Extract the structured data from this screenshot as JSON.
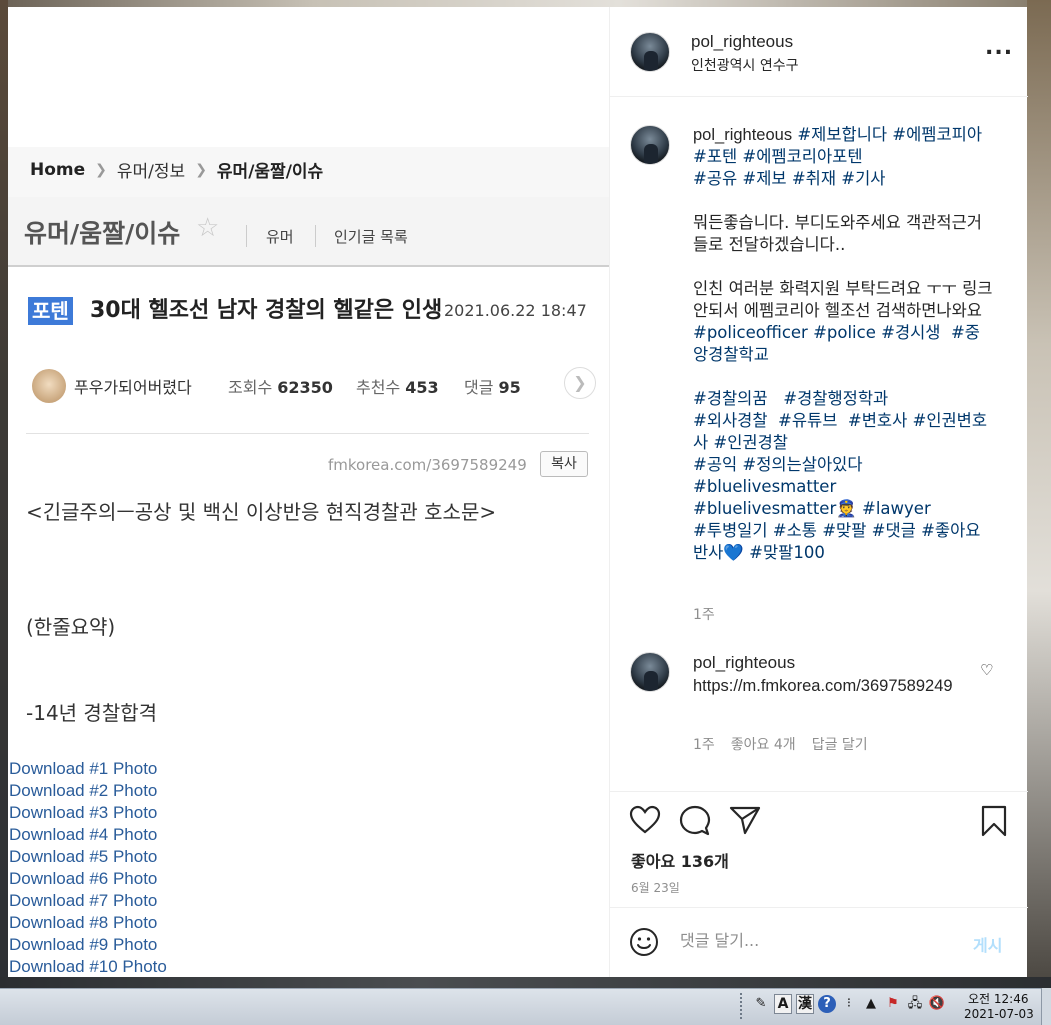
{
  "image_post": {
    "breadcrumb": {
      "home": "Home",
      "level1": "유머/정보",
      "level2": "유머/움짤/이슈"
    },
    "board": {
      "title": "유머/움짤/이슈",
      "link1": "유머",
      "link2": "인기글 목록"
    },
    "post": {
      "tag": "포텐",
      "title": "30대 헬조선 남자 경찰의 헬같은 인생",
      "date": "2021.06.22 18:47",
      "author": "푸우가되어버렸다",
      "views_label": "조회수",
      "views": "62350",
      "recommend_label": "추천수",
      "recommend": "453",
      "comments_label": "댓글",
      "comments": "95",
      "url": "fmkorea.com/3697589249",
      "copy_label": "복사",
      "body": [
        "<긴글주의ㅡ공상 및 백신 이상반응 현직경찰관 호소문>",
        "(한줄요약)",
        "-14년 경찰합격"
      ]
    }
  },
  "downloads": [
    "Download #1 Photo",
    "Download #2 Photo",
    "Download #3 Photo",
    "Download #4 Photo",
    "Download #5 Photo",
    "Download #6 Photo",
    "Download #7 Photo",
    "Download #8 Photo",
    "Download #9 Photo",
    "Download #10 Photo"
  ],
  "instagram": {
    "header": {
      "username": "pol_righteous",
      "location": "인천광역시 연수구",
      "more": "..."
    },
    "caption": {
      "username": "pol_righteous",
      "tags1": "#제보합니다 #에펨코피아 #포텐 #에펨코리아포텐\n#공유 #제보 #취재 #기사",
      "text1": "\n\n뭐든좋습니다. 부디도와주세요 객관적근거들로 전달하겠습니다..\n\n인친 여러분 화력지원 부탁드려요 ㅜㅜ 링크안되서 에펨코리아 헬조선 검색하면나와요\n",
      "tags2": "#policeofficer #police #경시생  #중앙경찰학교\n\n#경찰의꿈   #경찰행정학과\n#외사경찰  #유튜브  #변호사 #인권변호사 #인권경찰\n#공익 #정의는살아있다\n#bluelivesmatter\n#bluelivesmatter👮 #lawyer\n#투병일기 #소통 #맞팔 #댓글 #좋아요반사💙 #맞팔100",
      "time": "1주"
    },
    "comment": {
      "username": "pol_righteous",
      "text": "https://m.fmkorea.com/3697589249",
      "time": "1주",
      "likes": "좋아요 4개",
      "reply": "답글 달기"
    },
    "likes": "좋아요 136개",
    "date": "6월 23일",
    "comment_placeholder": "댓글 달기...",
    "post_button": "게시"
  },
  "taskbar": {
    "ime_mode": "A",
    "ime_hanja": "漢",
    "time": "오전 12:46",
    "date": "2021-07-03"
  }
}
